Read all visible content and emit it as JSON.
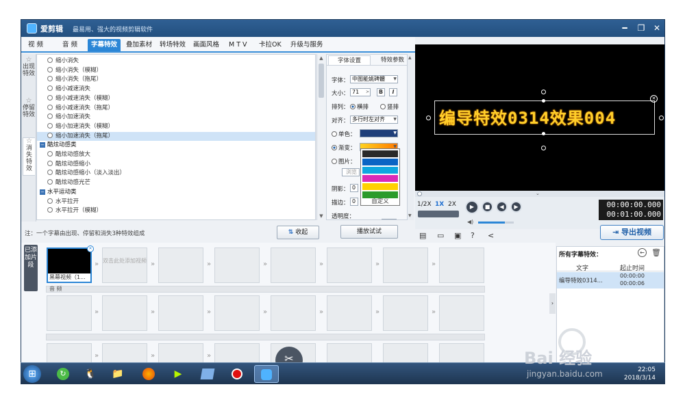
{
  "window": {
    "app_name": "爱剪辑",
    "slogan": "最易用、强大的视频剪辑软件",
    "controls": {
      "minimize": "━",
      "restore": "❐",
      "close": "✕"
    }
  },
  "tabs": [
    "视 频",
    "音 频",
    "字幕特效",
    "叠加素材",
    "转场特效",
    "画面风格",
    "M T V",
    "卡拉OK",
    "升级与服务"
  ],
  "side_tabs": [
    "出现特效",
    "停留特效",
    "消失特效"
  ],
  "effects": [
    {
      "label": "缩小消失",
      "kind": "item"
    },
    {
      "label": "缩小消失（模糊）",
      "kind": "item"
    },
    {
      "label": "缩小消失（拖尾）",
      "kind": "item"
    },
    {
      "label": "缩小减速消失",
      "kind": "item"
    },
    {
      "label": "缩小减速消失（模糊）",
      "kind": "item"
    },
    {
      "label": "缩小减速消失（拖尾）",
      "kind": "item"
    },
    {
      "label": "缩小加速消失",
      "kind": "item"
    },
    {
      "label": "缩小加速消失（模糊）",
      "kind": "item"
    },
    {
      "label": "缩小加速消失（拖尾）",
      "kind": "item",
      "selected": true
    },
    {
      "label": "酷炫动感类",
      "kind": "category"
    },
    {
      "label": "酷炫动感放大",
      "kind": "item"
    },
    {
      "label": "酷炫动感缩小",
      "kind": "item"
    },
    {
      "label": "酷炫动感缩小（淡入淡出）",
      "kind": "item"
    },
    {
      "label": "酷炫动感光芒",
      "kind": "item"
    },
    {
      "label": "水平运动类",
      "kind": "category"
    },
    {
      "label": "水平拉开",
      "kind": "item"
    },
    {
      "label": "水平拉开（模糊）",
      "kind": "item"
    }
  ],
  "note": "注：一个字幕由出现、停留和消失3种特效组成",
  "collapse_button": "收起",
  "play_test_button": "播放试试",
  "props": {
    "tabs": [
      "字体设置",
      "特效参数"
    ],
    "font_label": "字体：",
    "font_value": "中图能姚碑體",
    "size_label": "大小：",
    "size_value": "71",
    "bold": "B",
    "italic": "I",
    "arrange_label": "排列：",
    "arrange_h": "横排",
    "arrange_v": "竖排",
    "align_label": "对齐：",
    "align_value": "多行时左对齐",
    "solid_label": "单色：",
    "gradient_label": "渐变：",
    "image_label": "图片：",
    "browse_label": "浏览",
    "shadow_label": "阴影：",
    "shadow_value": "0",
    "stroke_label": "描边：",
    "stroke_value": "0",
    "opacity_label": "透明度：",
    "opacity_value": "0%",
    "custom_label": "自定义",
    "colors": {
      "solid": "#1f3f7a",
      "gradient_a": "#ffd21f",
      "gradient_b": "#ff7a00"
    }
  },
  "palette": [
    "#2a2a2a",
    "#0b64c4",
    "#0fa7e0",
    "#d92bb8",
    "#ffd100",
    "#2b9b2b"
  ],
  "preview": {
    "overlay_text": "编导特效0314效果004"
  },
  "player": {
    "speeds": [
      "1/2X",
      "1X",
      "2X"
    ],
    "active_speed": "1X",
    "time_current": "00:00:00.000",
    "time_total": "00:01:00.000",
    "volume": 0.75
  },
  "export_button": "导出视频",
  "timeline": {
    "added_label": "已添加片段",
    "first_clip_label": "黑幕视频（1...",
    "add_hint": "双击此处添加视频",
    "audio_label": "音 频"
  },
  "subtitle_panel": {
    "title": "所有字幕特效：",
    "col_text": "文字",
    "col_time": "起止时间",
    "row_text": "编导特效0314...",
    "row_start": "00:00:00",
    "row_end": "00:00:06"
  },
  "taskbar": {
    "time": "22:05",
    "date": "2018/3/14"
  },
  "watermark": {
    "brand": "Bai 经验",
    "url": "jingyan.baidu.com"
  }
}
